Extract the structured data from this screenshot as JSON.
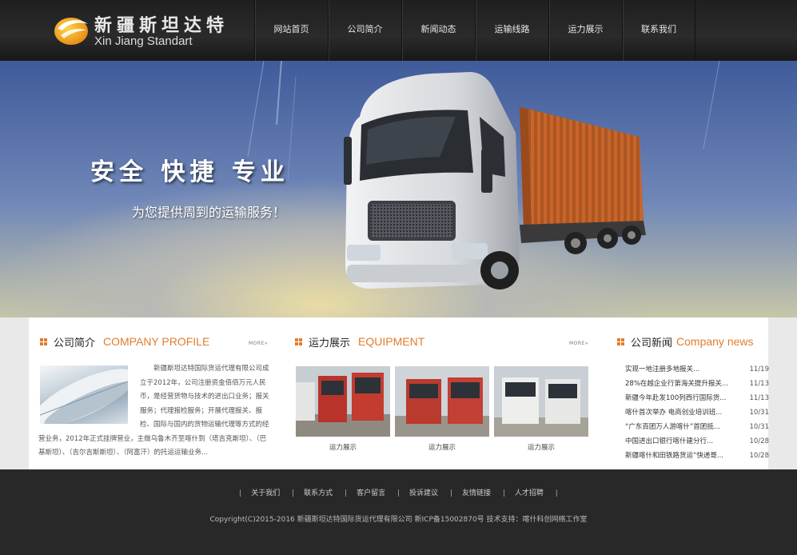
{
  "brand": {
    "name_cn": "新疆斯坦达特",
    "name_en": "Xin Jiang Standart",
    "logo_icon": "swirl-logo-icon",
    "accent_color": "#e27c2c"
  },
  "nav": {
    "items": [
      {
        "label": "网站首页"
      },
      {
        "label": "公司简介"
      },
      {
        "label": "新闻动态"
      },
      {
        "label": "运输线路"
      },
      {
        "label": "运力展示"
      },
      {
        "label": "联系我们"
      }
    ]
  },
  "banner": {
    "slogan": "安全 快捷 专业",
    "subtitle": "为您提供周到的运输服务！"
  },
  "profile": {
    "title_cn": "公司简介",
    "title_en": "COMPANY PROFILE",
    "more_label": "MORE»",
    "text": "　　新疆斯坦达特国际货运代理有限公司成立于2012年，公司注册资金佰佰万元人民币，是经营货物与技术的进出口业务；报关服务；代理报检服务；开展代理报关、报检、国际与国内的货物运输代理等方式的经营业务，2012年正式挂牌营业，主做乌鲁木齐至喀什到（塔吉克斯坦）、（巴基斯坦）、（吉尔吉斯斯坦）、（阿富汗）的托运运输业务..."
  },
  "equipment": {
    "title_cn": "运力展示",
    "title_en": "EQUIPMENT",
    "more_label": "MORE»",
    "items": [
      {
        "label": "运力展示"
      },
      {
        "label": "运力展示"
      },
      {
        "label": "运力展示"
      }
    ]
  },
  "news": {
    "title_cn": "公司新闻",
    "title_en": "Company news",
    "items": [
      {
        "title": "实现一地注册多地报关...",
        "date": "11/19"
      },
      {
        "title": "28%在越企业行第海关提升报关...",
        "date": "11/13"
      },
      {
        "title": "新疆今年赴发100列西行国际货...",
        "date": "11/13"
      },
      {
        "title": "喀什首次举办 电商创业培训班...",
        "date": "10/31"
      },
      {
        "title": "“广东百团万人游喀什”首团抵...",
        "date": "10/31"
      },
      {
        "title": "中国进出口银行喀什建分行...",
        "date": "10/28"
      },
      {
        "title": "新疆喀什和田铁路货运“快递哥...",
        "date": "10/28"
      }
    ]
  },
  "footer": {
    "links": [
      {
        "label": "关于我们"
      },
      {
        "label": "联系方式"
      },
      {
        "label": "客户留言"
      },
      {
        "label": "投诉建议"
      },
      {
        "label": "友情链接"
      },
      {
        "label": "人才招聘"
      }
    ],
    "copyright": "Copyright(C)2015-2016 新疆斯坦达特国际货运代理有限公司  新ICP备15002870号   技术支持：喀什科创网络工作室"
  }
}
